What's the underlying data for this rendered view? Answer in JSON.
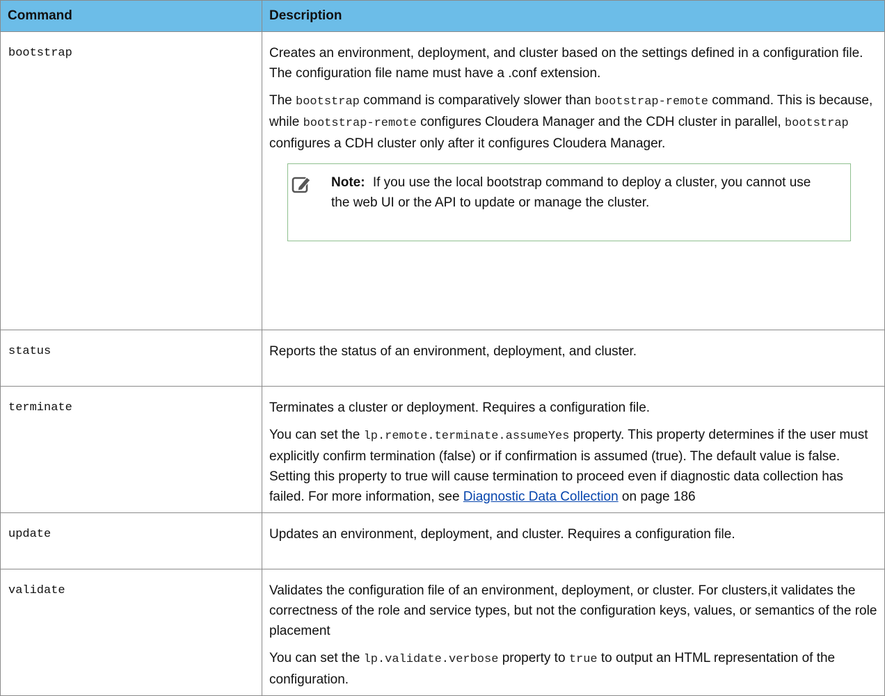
{
  "headers": {
    "command": "Command",
    "description": "Description"
  },
  "rows": {
    "bootstrap": {
      "command": "bootstrap",
      "p1": "Creates an environment, deployment, and cluster based on the settings defined in a configuration file. The configuration file name must have a .conf extension.",
      "p2": {
        "t1": "The ",
        "c1": "bootstrap",
        "t2": " command is comparatively slower than ",
        "c2": "bootstrap-remote",
        "t3": " command. This is because, while ",
        "c3": "bootstrap-remote",
        "t4": " configures Cloudera Manager and the CDH cluster in parallel, ",
        "c4": "bootstrap",
        "t5": " configures a CDH cluster only after it configures Cloudera Manager."
      },
      "note": {
        "label": "Note:",
        "text": "If you use the local bootstrap command to deploy a cluster, you cannot use the web UI or the API to update or manage the cluster."
      }
    },
    "status": {
      "command": "status",
      "p1": "Reports the status of an environment, deployment, and cluster."
    },
    "terminate": {
      "command": "terminate",
      "p1": "Terminates a cluster or deployment. Requires a configuration file.",
      "p2": {
        "t1": "You can set the ",
        "c1": "lp.remote.terminate.assumeYes",
        "t2": "  property. This property determines if the user must explicitly confirm termination (false) or if confirmation is assumed (true). The default value is false. Setting this property to true will cause termination to proceed even if diagnostic data collection has failed. For more information, see ",
        "link": "Diagnostic Data Collection",
        "t3": " on page 186"
      }
    },
    "update": {
      "command": "update",
      "p1": "Updates an environment, deployment, and cluster. Requires a configuration file."
    },
    "validate": {
      "command": "validate",
      "p1": "Validates the configuration file of an environment, deployment, or cluster. For clusters,it validates the correctness of the role and service types, but not the configuration keys, values, or semantics of the role placement",
      "p2": {
        "t1": "You can set the ",
        "c1": "lp.validate.verbose",
        "t2": " property to ",
        "c2": "true",
        "t3": " to output an HTML representation of the configuration."
      }
    }
  },
  "icons": {
    "note": "edit-note-icon"
  }
}
